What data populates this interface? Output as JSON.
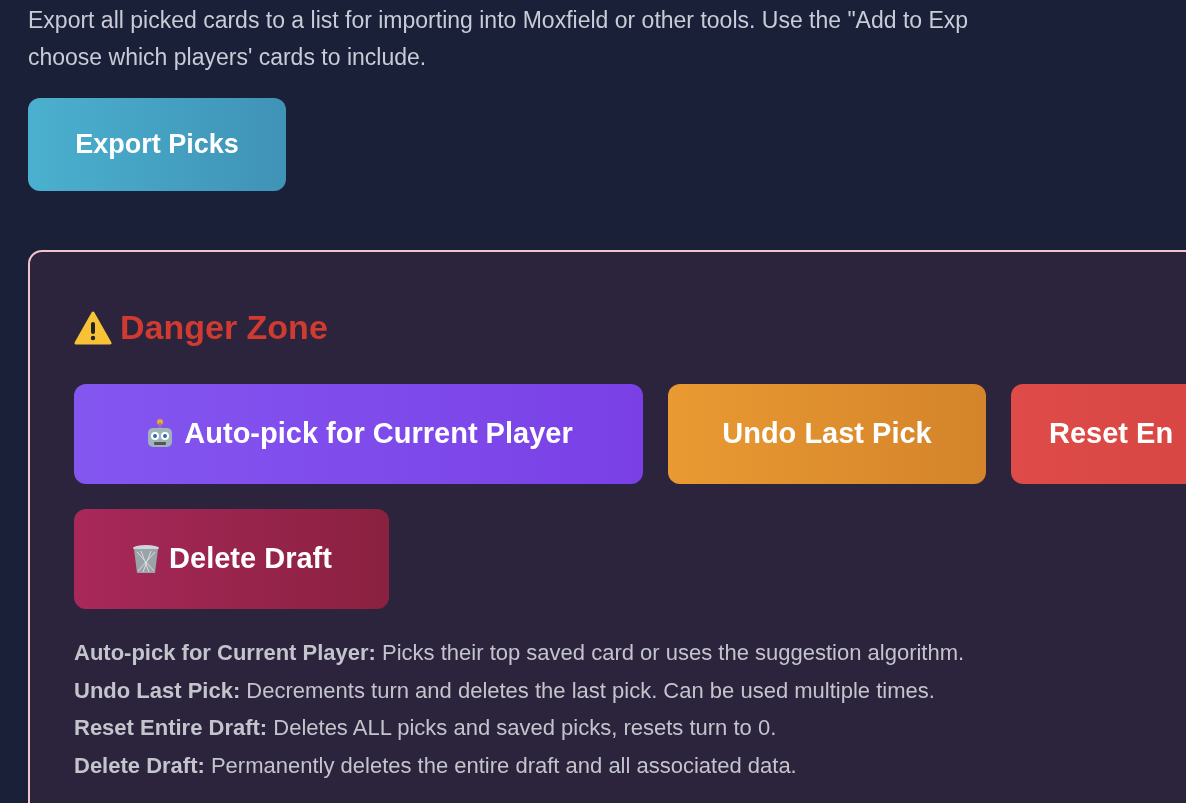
{
  "export": {
    "description_lines": [
      "Export all picked cards to a list for importing into Moxfield or other tools. Use the \"Add to Exp",
      "choose which players' cards to include."
    ],
    "button": "Export Picks"
  },
  "danger_zone": {
    "title": "Danger Zone",
    "buttons": [
      {
        "label": "Auto-pick for Current Player",
        "kind": "autopick"
      },
      {
        "label": "Undo Last Pick",
        "kind": "undo"
      },
      {
        "label": "Reset En",
        "kind": "reset"
      },
      {
        "label": "Delete Draft",
        "kind": "delete"
      }
    ],
    "help": [
      "**Auto-pick for Current Player:** Picks their top saved card or uses the suggestion algorithm.",
      "**Undo Last Pick:** Decrements turn and deletes the last pick. Can be used multiple times.",
      "**Reset Entire Draft:** Deletes ALL picks and saved picks, resets turn to 0.",
      "**Delete Draft:** Permanently deletes the entire draft and all associated data."
    ]
  }
}
